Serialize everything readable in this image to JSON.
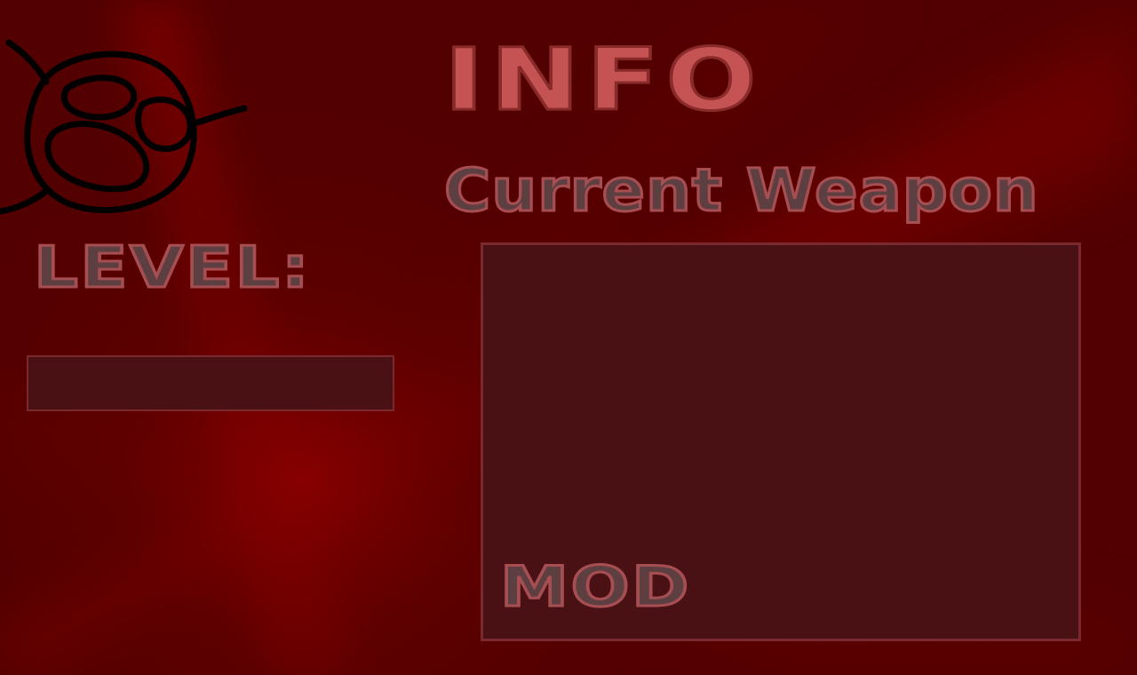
{
  "header": {
    "title": "INFO"
  },
  "weapon": {
    "title": "Current Weapon",
    "mod_label": "MOD"
  },
  "level": {
    "label": "LEVEL:"
  },
  "logo": {
    "icon": "doodle-face-logo"
  },
  "colors": {
    "background": "#520000",
    "glow": "#8a0000",
    "panel": "#4a1115",
    "panel_border": "#7a2a2e",
    "title_fill": "#c55353",
    "label_fill": "#5e3f41",
    "label_stroke": "#a74e52"
  }
}
